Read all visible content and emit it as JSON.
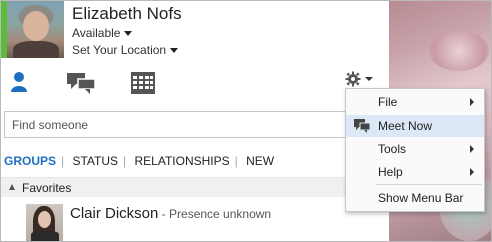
{
  "user": {
    "name": "Elizabeth Nofs",
    "status": "Available",
    "location": "Set Your Location",
    "presence_color": "#5dbb3b"
  },
  "toolbar": {
    "icons": [
      "contacts-icon",
      "conversations-icon",
      "meetings-icon",
      "gear-icon"
    ]
  },
  "search": {
    "placeholder": "Find someone"
  },
  "tabs": {
    "groups": "GROUPS",
    "status": "STATUS",
    "relationships": "RELATIONSHIPS",
    "new": "NEW",
    "active_color": "#1e6fc0"
  },
  "group": {
    "label": "Favorites"
  },
  "contact": {
    "name": "Clair Dickson",
    "presence": " - Presence unknown"
  },
  "menu": {
    "file": "File",
    "meet_now": "Meet Now",
    "tools": "Tools",
    "help": "Help",
    "show_menu_bar": "Show Menu Bar",
    "highlight_color": "#dce8f5"
  }
}
